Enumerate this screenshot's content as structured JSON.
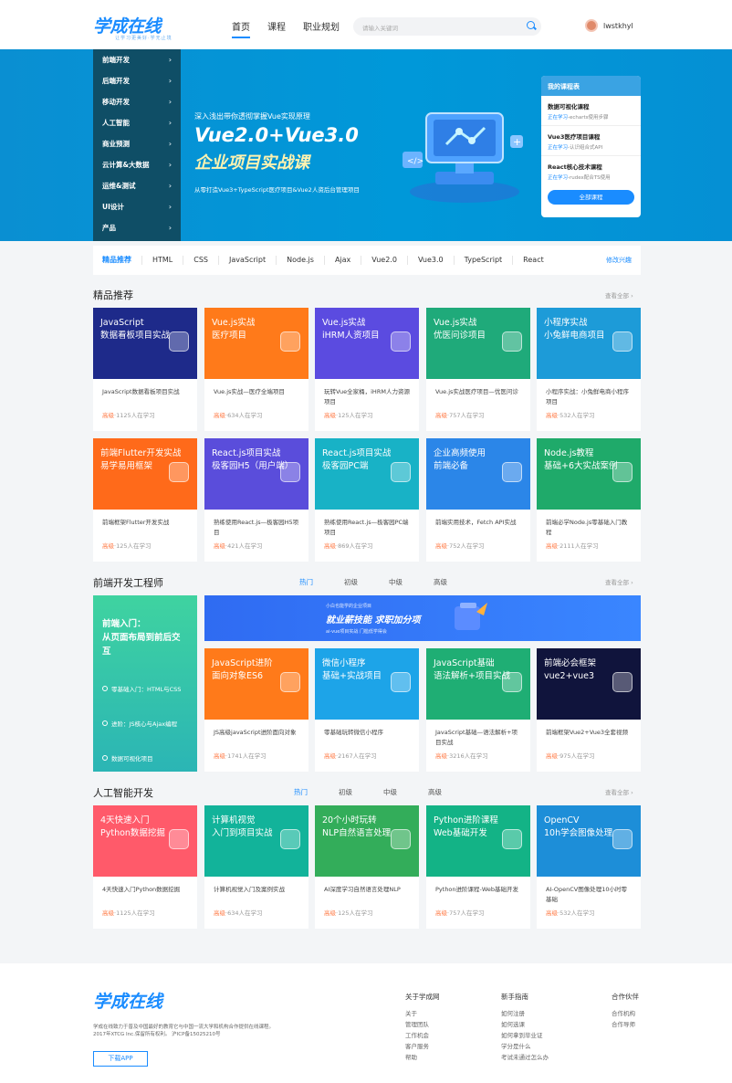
{
  "header": {
    "logo": "学成在线",
    "slogan": "让学习更美好·学无止境",
    "nav": [
      "首页",
      "课程",
      "职业规划"
    ],
    "search_placeholder": "请输入关键词",
    "username": "lwstkhyl"
  },
  "banner": {
    "categories": [
      "前端开发",
      "后端开发",
      "移动开发",
      "人工智能",
      "商业预测",
      "云计算&大数据",
      "运维&测试",
      "UI设计",
      "产品"
    ],
    "subtitle": "深入浅出带你透彻掌握Vue实现原理",
    "title": "Vue2.0+Vue3.0",
    "title2": "企业项目实战课",
    "footnote": "从零打造Vue3+TypeScript医疗项目&Vue2人资后台管理项目",
    "mycourse": {
      "header": "我的课程表",
      "items": [
        {
          "title": "数据可视化课程",
          "progress_label": "正在学习",
          "progress_text": "-echarts使用步骤"
        },
        {
          "title": "Vue3医疗项目课程",
          "progress_label": "正在学习",
          "progress_text": "-认识组合式API"
        },
        {
          "title": "React核心技术课程",
          "progress_label": "正在学习",
          "progress_text": "-rudex配合TS使用"
        }
      ],
      "button": "全部课程"
    }
  },
  "tagbar": {
    "tags": [
      "精品推荐",
      "HTML",
      "CSS",
      "JavaScript",
      "Node.js",
      "Ajax",
      "Vue2.0",
      "Vue3.0",
      "TypeScript",
      "React"
    ],
    "edit": "修改兴趣"
  },
  "sections": {
    "featured": {
      "title": "精品推荐",
      "more": "查看全部"
    },
    "frontend": {
      "title": "前端开发工程师",
      "more": "查看全部",
      "tabs": [
        "热门",
        "初级",
        "中级",
        "高级"
      ]
    },
    "ai": {
      "title": "人工智能开发",
      "more": "查看全部",
      "tabs": [
        "热门",
        "初级",
        "中级",
        "高级"
      ]
    }
  },
  "featured_cards": [
    {
      "cover": "JavaScript\n数据看板项目实战",
      "name": "JavaScript数据看板项目实战",
      "level": "高级",
      "count": "·1125人在学习",
      "color": "#1e2a8a"
    },
    {
      "cover": "Vue.js实战\n医疗项目",
      "name": "Vue.js实战—医疗全端项目",
      "level": "高级",
      "count": "·634人在学习",
      "color": "#ff7a1a"
    },
    {
      "cover": "Vue.js实战\niHRM人资项目",
      "name": "玩转Vue全家桶，iHRM人力资源项目",
      "level": "高级",
      "count": "·125人在学习",
      "color": "#5b4be0"
    },
    {
      "cover": "Vue.js实战\n优医问诊项目",
      "name": "Vue.js实战医疗项目—优医问诊",
      "level": "高级",
      "count": "·757人在学习",
      "color": "#1faa7a"
    },
    {
      "cover": "小程序实战\n小兔鲜电商项目",
      "name": "小程序实战：小兔鲜电商小程序项目",
      "level": "高级",
      "count": "·532人在学习",
      "color": "#1d9bd8"
    },
    {
      "cover": "前端Flutter开发实战\n易学易用框架",
      "name": "前端框架Flutter开发实战",
      "level": "高级",
      "count": "·125人在学习",
      "color": "#ff6a1a"
    },
    {
      "cover": "React.js项目实战\n极客园H5（用户端）",
      "name": "熟练使用React.js—极客园H5项目",
      "level": "高级",
      "count": "·421人在学习",
      "color": "#5a4ddb"
    },
    {
      "cover": "React.js项目实战\n极客园PC端",
      "name": "熟练使用React.js—极客园PC端项目",
      "level": "高级",
      "count": "·869人在学习",
      "color": "#18b2c6"
    },
    {
      "cover": "企业高频使用\n前端必备",
      "name": "前端实用技术，Fetch API实战",
      "level": "高级",
      "count": "·752人在学习",
      "color": "#2b86e8"
    },
    {
      "cover": "Node.js教程\n基础+6大实战案例",
      "name": "前端必学Node.js零基础入门教程",
      "level": "高级",
      "count": "·2111人在学习",
      "color": "#1faa6a"
    }
  ],
  "frontend_promo": {
    "side_title": "前端入门：\n从页面布局到前后交互",
    "side_items": [
      "零基础入门：HTML与CSS",
      "进阶：JS核心与Ajax编程",
      "数据可视化项目"
    ],
    "banner_top": "小白也能学的企业项目",
    "banner_main": "就业薪技能 求职加分项",
    "banner_sub": "ai-vue项目实战  门槛低学得会"
  },
  "frontend_cards": [
    {
      "cover": "JavaScript进阶\n面向对象ES6",
      "name": "JS高级javaScript进阶面向对象",
      "level": "高级",
      "count": "·1741人在学习",
      "color": "#ff7a1a"
    },
    {
      "cover": "微信小程序\n基础+实战项目",
      "name": "零基础玩转微信小程序",
      "level": "高级",
      "count": "·2167人在学习",
      "color": "#1da4e8"
    },
    {
      "cover": "JavaScript基础\n语法解析+项目实战",
      "name": "JavaScript基础—语法解析+项目实战",
      "level": "高级",
      "count": "·3216人在学习",
      "color": "#1fae74"
    },
    {
      "cover": "前端必会框架\nvue2+vue3",
      "name": "前端框架Vue2+Vue3全套视频",
      "level": "高级",
      "count": "·975人在学习",
      "color": "#10143c"
    }
  ],
  "ai_cards": [
    {
      "cover": "4天快速入门\nPython数据挖掘",
      "name": "4天快速入门Python数据挖掘",
      "level": "高级",
      "count": "·1125人在学习",
      "color": "#ff5a6a"
    },
    {
      "cover": "计算机视觉\n入门到项目实战",
      "name": "计算机视觉入门及案例实战",
      "level": "高级",
      "count": "·634人在学习",
      "color": "#12b39a"
    },
    {
      "cover": "20个小时玩转\nNLP自然语言处理",
      "name": "AI深度学习自然语言处理NLP",
      "level": "高级",
      "count": "·125人在学习",
      "color": "#33ad5a"
    },
    {
      "cover": "Python进阶课程\nWeb基础开发",
      "name": "Python进阶课程-Web基础开发",
      "level": "高级",
      "count": "·757人在学习",
      "color": "#13b386"
    },
    {
      "cover": "OpenCV\n10h学会图像处理",
      "name": "AI-OpenCV图像处理10小时零基础",
      "level": "高级",
      "count": "·532人在学习",
      "color": "#1d8ed8"
    }
  ],
  "footer": {
    "logo": "学成在线",
    "desc": "学成在线致力于普及中国最好的教育它与中国一流大学和机构合作提供在线课程。\n2017年XTCG Inc.保留所有权利。 沪ICP备15025210号",
    "app_button": "下载APP",
    "columns": [
      {
        "title": "关于学成网",
        "links": [
          "关于",
          "管理团队",
          "工作机会",
          "客户服务",
          "帮助"
        ]
      },
      {
        "title": "新手指南",
        "links": [
          "如何注册",
          "如何选课",
          "如何拿到毕业证",
          "学分是什么",
          "考试未通过怎么办"
        ]
      },
      {
        "title": "合作伙伴",
        "links": [
          "合作机构",
          "合作导师"
        ]
      }
    ]
  }
}
